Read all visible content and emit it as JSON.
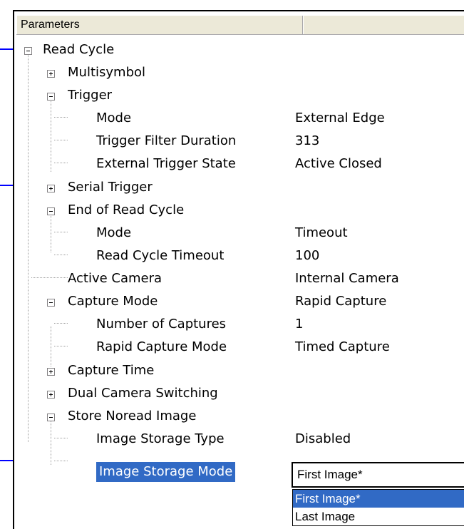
{
  "header": {
    "col1": "Parameters",
    "col2": ""
  },
  "tree": {
    "read_cycle": "Read Cycle",
    "multisymbol": "Multisymbol",
    "trigger": "Trigger",
    "trigger_mode": {
      "label": "Mode",
      "value": "External Edge"
    },
    "trigger_filter": {
      "label": "Trigger Filter Duration",
      "value": "313"
    },
    "external_trigger_state": {
      "label": "External Trigger State",
      "value": "Active Closed"
    },
    "serial_trigger": "Serial Trigger",
    "end_of_read_cycle": "End of Read Cycle",
    "eorc_mode": {
      "label": "Mode",
      "value": "Timeout"
    },
    "read_cycle_timeout": {
      "label": "Read Cycle Timeout",
      "value": "100"
    },
    "active_camera": {
      "label": "Active Camera",
      "value": "Internal Camera"
    },
    "capture_mode": {
      "label": "Capture Mode",
      "value": "Rapid Capture"
    },
    "number_of_captures": {
      "label": "Number of Captures",
      "value": "1"
    },
    "rapid_capture_mode": {
      "label": "Rapid Capture Mode",
      "value": "Timed Capture"
    },
    "capture_time": "Capture Time",
    "dual_camera_switching": "Dual Camera Switching",
    "store_noread_image": "Store Noread Image",
    "image_storage_type": {
      "label": "Image Storage Type",
      "value": "Disabled"
    },
    "image_storage_mode": {
      "label": "Image Storage Mode",
      "value": "First Image*"
    }
  },
  "dropdown": {
    "options": [
      "First Image*",
      "Last Image"
    ],
    "selected_index": 0
  },
  "colors": {
    "selection": "#316ac5",
    "arrow": "#0000ff",
    "header_bg": "#ece9d8"
  }
}
